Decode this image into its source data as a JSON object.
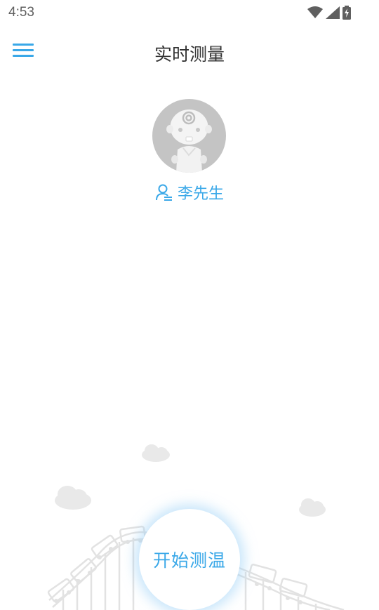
{
  "status_bar": {
    "time": "4:53",
    "icons": [
      "wifi-icon",
      "cell-signal-icon",
      "battery-charging-icon"
    ]
  },
  "app_bar": {
    "menu_icon": "hamburger-menu-icon",
    "title": "实时测量"
  },
  "profile": {
    "avatar_icon": "baby-avatar",
    "user_icon": "user-icon",
    "name": "李先生"
  },
  "action": {
    "start_label": "开始测温"
  },
  "colors": {
    "accent": "#3aa8e8",
    "title": "#333333",
    "avatar_bg": "#c4c4c4",
    "status_text": "#5f5f5f"
  }
}
